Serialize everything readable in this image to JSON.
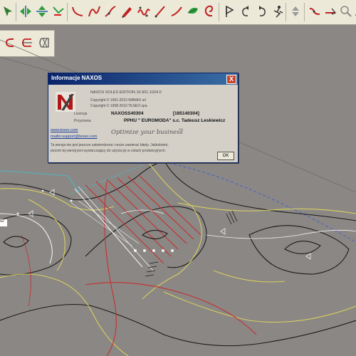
{
  "toolbar": {
    "icons": [
      "navigate-arrow-icon",
      "move-horizontal-icon",
      "flip-vertical-icon",
      "scissor-cut-icon",
      "curve-line-icon",
      "curve-s-icon",
      "spline-icon",
      "pencil-icon",
      "wave-curve-icon",
      "diagonal-line-icon",
      "line-segment-icon",
      "leaf-shape-icon",
      "spiral-icon",
      "flag-tool-icon",
      "rotate-left-icon",
      "rotate-right-icon",
      "spring-person-icon",
      "scroll-arrows-icon",
      "offset-line-icon",
      "double-line-icon",
      "zoom-icon",
      "tool-extra-icon"
    ]
  },
  "toolbar2": {
    "icons": [
      "c-curve-icon",
      "rect-mark-icon",
      "grid-mark-icon"
    ]
  },
  "dialog": {
    "title": "Informacje NAXOS",
    "close_symbol": "X",
    "edition": "NAXOS SOLES EDITION 10.901.1024.0",
    "copyright1": "Copyright © 1991-2010 WANAX srl",
    "copyright2": "Copyright © 1998-2010 TESEO spa",
    "license_label": "Licencja",
    "license_value": "NAXOSS40304",
    "license_number": "[185140304]",
    "assigned_label": "Przyznana",
    "assigned_value": "PPHU \" EUROMODA\" s.c. Tadeusz Leskiewicz",
    "website": "www.teseo.com",
    "email": "mailto:support@teseo.com",
    "slogan": "Optimize your business",
    "trademark": "TM",
    "notice_line1": "Ta wersja nie jest jeszcze zatwierdzona i może zawierać błędy. Jakkolwiek,",
    "notice_line2": "pozom tej wersji jest wystarczający do użycia jej w celach produkcyjnych.",
    "ok_label": "OK"
  },
  "canvas": {
    "background_color": "#8b8784",
    "line_colors": {
      "yellow": "#d8d060",
      "red": "#c43030",
      "white": "#f2f2f2",
      "black": "#1b1b1b",
      "blue": "#4a64c8",
      "cyan": "#4fb5c2"
    },
    "small_tag": "SO"
  }
}
